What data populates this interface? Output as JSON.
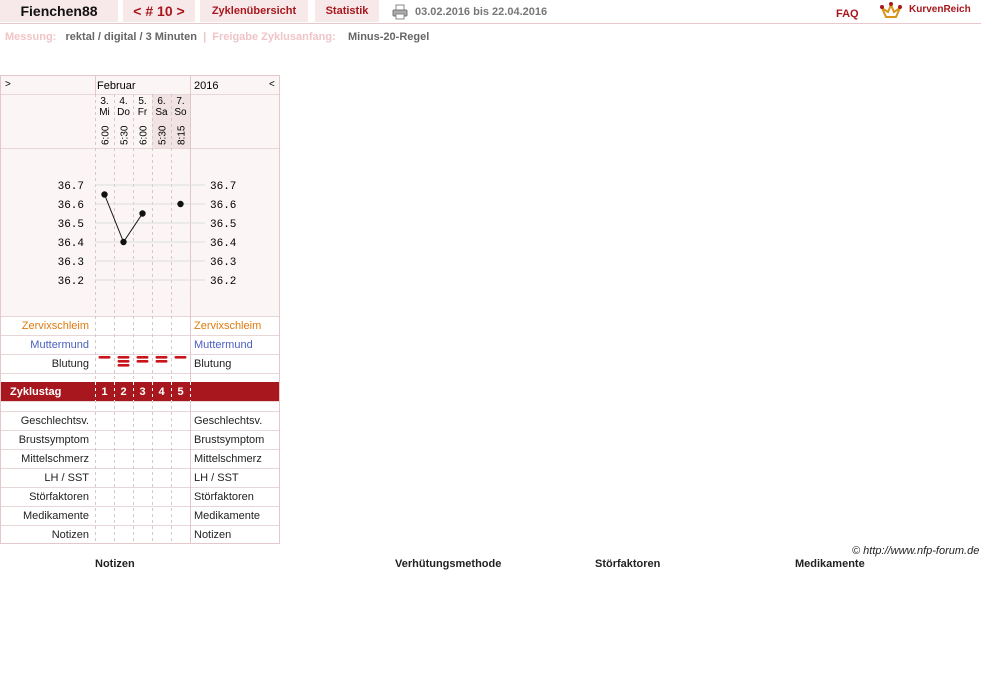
{
  "header": {
    "username": "Fienchen88",
    "cycle_nav": "< # 10 >",
    "tab_overview": "Zyklenübersicht",
    "tab_stats": "Statistik",
    "date_range": "03.02.2016 bis 22.04.2016",
    "faq": "FAQ",
    "brand": "KurvenReich",
    "printer_icon": "printer-icon",
    "brand_icon": "crown-icon"
  },
  "info": {
    "measure_label": "Messung:",
    "measure_value": "rektal / digital / 3 Minuten",
    "separator": "|",
    "release_label": "Freigabe Zyklusanfang:",
    "release_value": "Minus-20-Regel"
  },
  "chart_header": {
    "nav_left": ">",
    "nav_right": "<",
    "month": "Februar",
    "year": "2016"
  },
  "days": [
    {
      "date": "3.",
      "weekday": "Mi",
      "time": "6:00",
      "weekend": false
    },
    {
      "date": "4.",
      "weekday": "Do",
      "time": "5:30",
      "weekend": false
    },
    {
      "date": "5.",
      "weekday": "Fr",
      "time": "6:00",
      "weekend": false
    },
    {
      "date": "6.",
      "weekday": "Sa",
      "time": "5:30",
      "weekend": true
    },
    {
      "date": "7.",
      "weekday": "So",
      "time": "8:15",
      "weekend": true
    }
  ],
  "chart_data": {
    "type": "line",
    "title": "",
    "xlabel": "",
    "ylabel": "",
    "categories": [
      "3. Mi",
      "4. Do",
      "5. Fr",
      "6. Sa",
      "7. So"
    ],
    "series": [
      {
        "values": [
          36.65,
          36.4,
          36.55,
          null,
          36.6
        ]
      }
    ],
    "ylim": [
      36.2,
      36.7
    ],
    "yticks": [
      "36.7",
      "36.6",
      "36.5",
      "36.4",
      "36.3",
      "36.2"
    ],
    "grid": true,
    "connected_segments": [
      [
        0,
        1
      ],
      [
        1,
        2
      ]
    ]
  },
  "rows": {
    "zervix": "Zervixschleim",
    "muttermund": "Muttermund",
    "blutung": "Blutung",
    "zyklustag": "Zyklustag",
    "geschlecht": "Geschlechtsv.",
    "brust": "Brustsymptom",
    "mittel": "Mittelschmerz",
    "lh": "LH / SST",
    "stoer": "Störfaktoren",
    "medi": "Medikamente",
    "notizen": "Notizen"
  },
  "bleeding": [
    1,
    3,
    2,
    2,
    1
  ],
  "cycle_days": [
    "1",
    "2",
    "3",
    "4",
    "5"
  ],
  "colors": {
    "accent": "#a8171d",
    "zervix": "#e07a10",
    "muttermund": "#4a5fbf",
    "grid": "#e3d0d1",
    "weekend_bg": "#f1e3e4"
  },
  "copyright": "© http://www.nfp-forum.de",
  "footer": {
    "notizen": "Notizen",
    "verhuetung": "Verhütungsmethode",
    "stoer": "Störfaktoren",
    "medi": "Medikamente"
  }
}
